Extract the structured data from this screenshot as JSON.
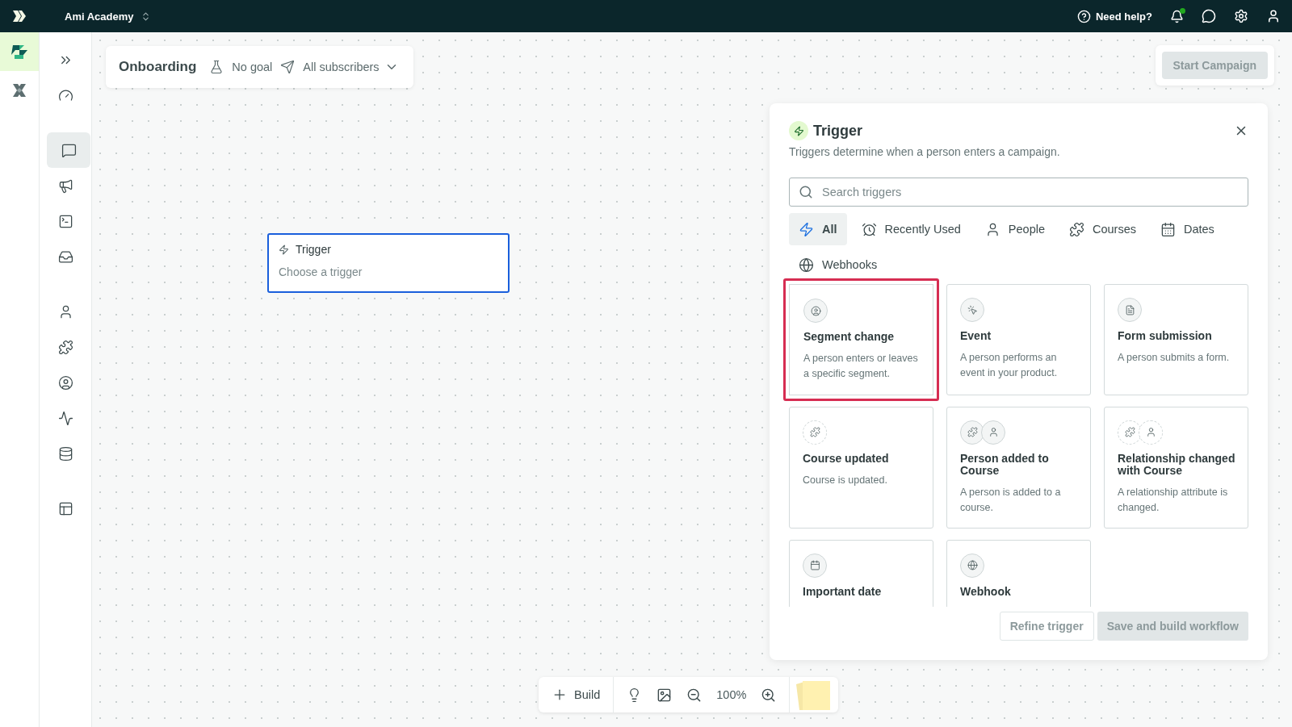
{
  "topbar": {
    "workspace": "Ami Academy",
    "help": "Need help?",
    "notifications_unread": true
  },
  "app_rail": [
    {
      "selected": true
    },
    {
      "selected": false
    }
  ],
  "nav_groups": [
    [
      {
        "selected": false
      },
      {
        "selected": false
      }
    ],
    [
      {
        "selected": true
      },
      {
        "selected": false
      },
      {
        "selected": false
      },
      {
        "selected": false
      }
    ],
    [
      {
        "selected": false
      },
      {
        "selected": false
      },
      {
        "selected": false
      },
      {
        "selected": false
      },
      {
        "selected": false
      }
    ],
    [
      {
        "selected": false
      }
    ]
  ],
  "campaign": {
    "name": "Onboarding",
    "goal": "No goal",
    "audience": "All subscribers",
    "start_button": {
      "label": "Start Campaign",
      "disabled": true
    }
  },
  "trigger_node": {
    "title": "Trigger",
    "subtitle": "Choose a trigger",
    "selected": true
  },
  "panel": {
    "title": "Trigger",
    "description": "Triggers determine when a person enters a campaign.",
    "search": {
      "placeholder": "Search triggers"
    },
    "tabs": [
      {
        "label": "All",
        "selected": true
      },
      {
        "label": "Recently Used",
        "selected": false
      },
      {
        "label": "People",
        "selected": false
      },
      {
        "label": "Courses",
        "selected": false
      },
      {
        "label": "Dates",
        "selected": false
      },
      {
        "label": "Webhooks",
        "selected": false
      }
    ],
    "cards": [
      {
        "title": "Segment change",
        "description": "A person enters or leaves a specific segment.",
        "selected": true,
        "dashed": false
      },
      {
        "title": "Event",
        "description": "A person performs an event in your product.",
        "selected": false,
        "dashed": false
      },
      {
        "title": "Form submission",
        "description": "A person submits a form.",
        "selected": false,
        "dashed": false
      },
      {
        "title": "Course updated",
        "description": "Course is updated.",
        "selected": false,
        "dashed": true
      },
      {
        "title": "Person added to Course",
        "description": "A person is added to a course.",
        "selected": false,
        "dashed": false
      },
      {
        "title": "Relationship changed with Course",
        "description": "A relationship attribute is changed.",
        "selected": false,
        "dashed": true
      },
      {
        "title": "Important date",
        "selected": false,
        "dashed": false
      },
      {
        "title": "Webhook",
        "selected": false,
        "dashed": false
      }
    ],
    "buttons": [
      {
        "label": "Refine trigger",
        "kind": "outline",
        "disabled": true
      },
      {
        "label": "Save and build workflow",
        "kind": "primary",
        "disabled": true
      }
    ]
  },
  "toolbar": {
    "build": "Build",
    "zoom": "100%"
  }
}
